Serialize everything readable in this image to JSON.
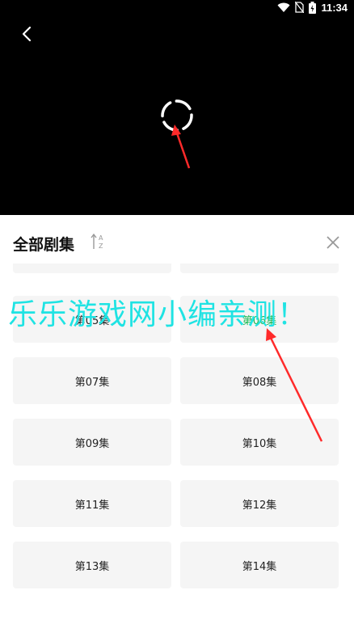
{
  "status_bar": {
    "time": "11:34",
    "icons": [
      "wifi-icon",
      "no-sim-icon",
      "battery-charging-icon"
    ]
  },
  "player": {
    "back_icon": "chevron-left-icon",
    "loading_icon": "loading-spinner-icon"
  },
  "episodes_panel": {
    "title": "全部剧集",
    "sort_icon": "sort-az-icon",
    "close_icon": "close-icon",
    "episodes": [
      "",
      "",
      "第05集",
      "第06集",
      "第07集",
      "第08集",
      "第09集",
      "第10集",
      "第11集",
      "第12集",
      "第13集",
      "第14集"
    ],
    "active_episode": "第06集"
  },
  "watermark": "乐乐游戏网小编亲测！",
  "colors": {
    "accent": "#1db954",
    "watermark": "#1fe3e3",
    "annotation_arrow": "#ff2a2a"
  }
}
